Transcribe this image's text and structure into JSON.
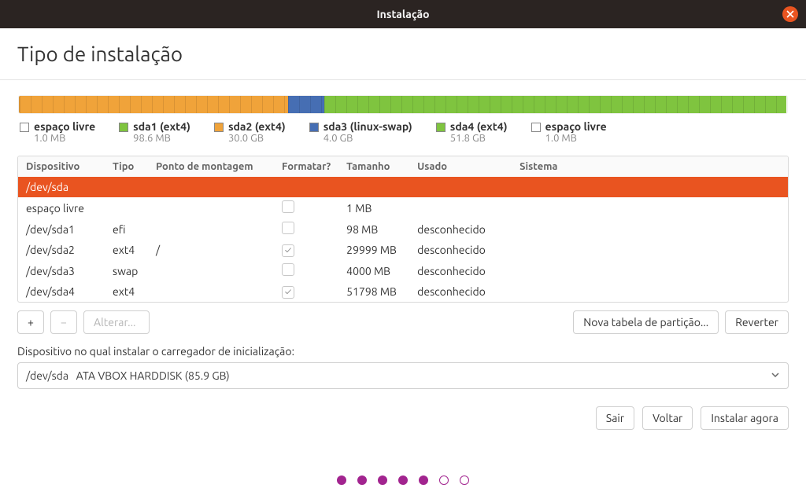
{
  "window": {
    "title": "Instalação"
  },
  "page": {
    "heading": "Tipo de instalação"
  },
  "colors": {
    "orange": "#f0a33a",
    "blue": "#466eb3",
    "green": "#7fc43f",
    "free": "#ffffff",
    "accent": "#e95420",
    "magenta": "#a2248f"
  },
  "segments": [
    {
      "color_key": "orange",
      "percent": 0.12
    },
    {
      "color_key": "orange",
      "percent": 34.9
    },
    {
      "color_key": "blue",
      "percent": 4.7
    },
    {
      "color_key": "green",
      "percent": 60.2
    }
  ],
  "legend": [
    {
      "color_key": "free",
      "name": "espaço livre",
      "size": "1.0 MB"
    },
    {
      "color_key": "green",
      "name": "sda1 (ext4)",
      "size": "98.6 MB"
    },
    {
      "color_key": "orange",
      "name": "sda2 (ext4)",
      "size": "30.0 GB"
    },
    {
      "color_key": "blue",
      "name": "sda3 (linux-swap)",
      "size": "4.0 GB"
    },
    {
      "color_key": "green",
      "name": "sda4 (ext4)",
      "size": "51.8 GB"
    },
    {
      "color_key": "free",
      "name": "espaço livre",
      "size": "1.0 MB"
    }
  ],
  "table": {
    "headers": {
      "device": "Dispositivo",
      "type": "Tipo",
      "mount": "Ponto de montagem",
      "format": "Formatar?",
      "size": "Tamanho",
      "used": "Usado",
      "system": "Sistema"
    },
    "rows": [
      {
        "device": "/dev/sda",
        "type": "",
        "mount": "",
        "format": null,
        "size": "",
        "used": "",
        "system": "",
        "selected": true
      },
      {
        "device": "espaço livre",
        "type": "",
        "mount": "",
        "format": false,
        "size": "1 MB",
        "used": "",
        "system": ""
      },
      {
        "device": "/dev/sda1",
        "type": "efi",
        "mount": "",
        "format": false,
        "size": "98 MB",
        "used": "desconhecido",
        "system": ""
      },
      {
        "device": "/dev/sda2",
        "type": "ext4",
        "mount": "/",
        "format": true,
        "size": "29999 MB",
        "used": "desconhecido",
        "system": ""
      },
      {
        "device": "/dev/sda3",
        "type": "swap",
        "mount": "",
        "format": false,
        "size": "4000 MB",
        "used": "desconhecido",
        "system": ""
      },
      {
        "device": "/dev/sda4",
        "type": "ext4",
        "mount": "",
        "format": true,
        "size": "51798 MB",
        "used": "desconhecido",
        "system": ""
      }
    ]
  },
  "buttons": {
    "add": "+",
    "remove": "−",
    "change": "Alterar...",
    "new_table": "Nova tabela de partição...",
    "revert": "Reverter",
    "quit": "Sair",
    "back": "Voltar",
    "install": "Instalar agora"
  },
  "bootloader": {
    "label": "Dispositivo no qual instalar o carregador de inicialização:",
    "device": "/dev/sda",
    "description": "ATA VBOX HARDDISK (85.9 GB)"
  },
  "progress": {
    "total": 7,
    "current": 5
  }
}
